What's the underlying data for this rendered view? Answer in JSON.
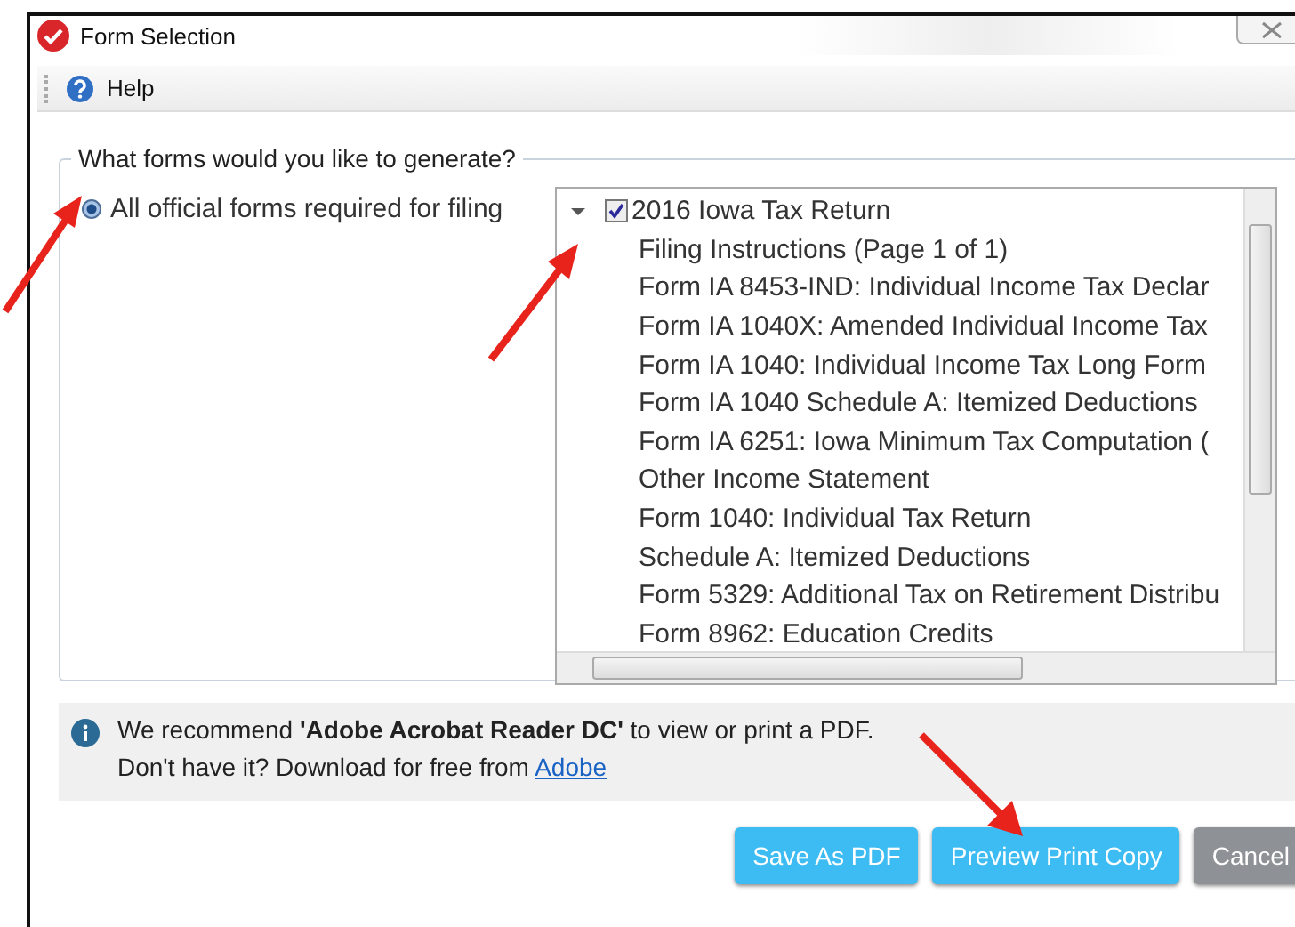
{
  "window": {
    "title": "Form Selection"
  },
  "toolbar": {
    "help_label": "Help"
  },
  "group": {
    "legend": "What forms would you like to generate?",
    "options": [
      {
        "label": "All official forms required for filing",
        "selected": true
      }
    ]
  },
  "tree": {
    "items": [
      {
        "label": "2016 Iowa Tax Return",
        "checked": true,
        "expanded": true,
        "children": [
          {
            "label": "Filing Instructions (Page 1 of 1)"
          },
          {
            "label": "Form IA 8453-IND: Individual Income Tax Declar"
          },
          {
            "label": "Form IA 1040X: Amended Individual Income Tax"
          },
          {
            "label": "Form IA 1040: Individual Income Tax Long Form"
          },
          {
            "label": "Form IA 1040 Schedule A: Itemized Deductions"
          },
          {
            "label": "Form IA 6251: Iowa Minimum Tax Computation ("
          },
          {
            "label": "Other Income Statement"
          },
          {
            "label": "Form 1040: Individual Tax Return"
          },
          {
            "label": "Schedule A: Itemized Deductions"
          },
          {
            "label": "Form 5329: Additional Tax on Retirement Distribu"
          },
          {
            "label": "Form 8962: Education Credits"
          }
        ]
      }
    ]
  },
  "info": {
    "line1": "We recommend **'Adobe Acrobat Reader DC'** to view or print a PDF.",
    "line2": "Don't have it? Download for free from",
    "link": "Adobe"
  },
  "buttons": [
    {
      "label": "Save As PDF",
      "kind": "primary"
    },
    {
      "label": "Preview Print Copy",
      "kind": "primary"
    },
    {
      "label": "Cancel",
      "kind": "secondary"
    }
  ]
}
